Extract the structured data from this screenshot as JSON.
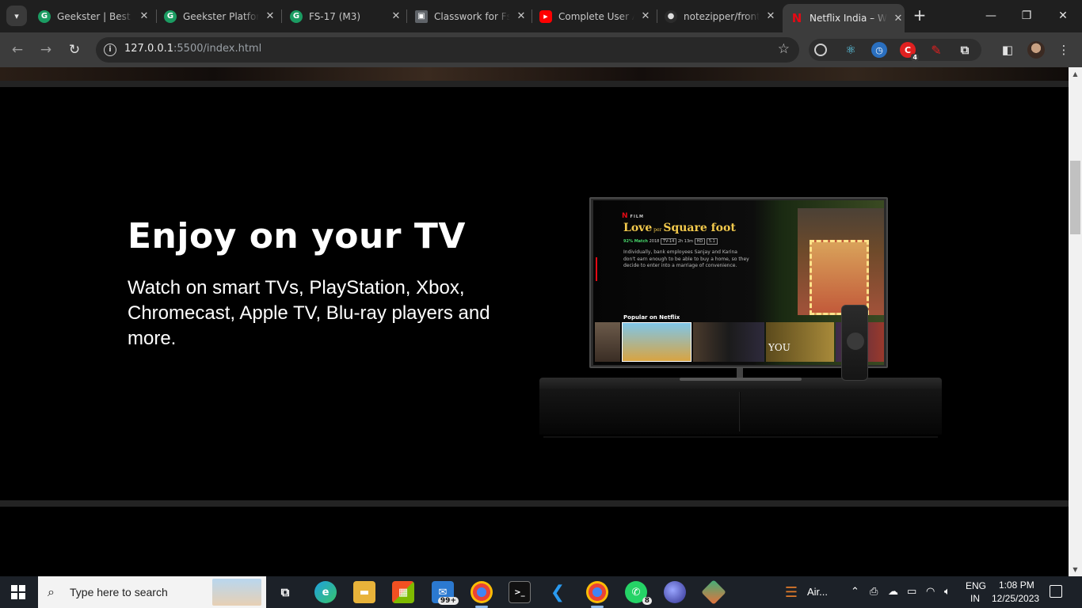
{
  "browser": {
    "tabs": [
      {
        "title": "Geekster | Best C",
        "favicon_color": "#1b9c62",
        "favicon_glyph": "G"
      },
      {
        "title": "Geekster Platform",
        "favicon_color": "#1b9c62",
        "favicon_glyph": "G"
      },
      {
        "title": "FS-17 (M3)",
        "favicon_color": "#1b9c62",
        "favicon_glyph": "G"
      },
      {
        "title": "Classwork for Fs",
        "favicon_color": "#5f6368",
        "favicon_glyph": "▣"
      },
      {
        "title": "Complete User A",
        "favicon_color": "#ff0000",
        "favicon_glyph": "▶"
      },
      {
        "title": "notezipper/front",
        "favicon_color": "#2b2b2b",
        "favicon_glyph": "●"
      },
      {
        "title": "Netflix India – W",
        "favicon_color": "#e50914",
        "favicon_glyph": "N",
        "active": true
      }
    ],
    "url_host": "127.0.0.1",
    "url_path": ":5500/index.html",
    "extension_badge": "4"
  },
  "page": {
    "headline": "Enjoy on your TV",
    "subtext": "Watch on smart TVs, PlayStation, Xbox, Chromecast, Apple TV, Blu-ray players and more.",
    "tv_screen": {
      "brand": "N",
      "brand_tag": "FILM",
      "title_part1": "Love",
      "title_small": "per",
      "title_part2": "Square foot",
      "match": "92% Match",
      "year": "2018",
      "rating": "TV-14",
      "duration": "2h 13m",
      "quality": "HD",
      "audio": "5.1",
      "description": "Individually, bank employees Sanjay and Karina don't earn enough to be able to buy a home, so they decide to enter into a marriage of convenience.",
      "row_title": "Popular on Netflix",
      "thumb_you": "YOU"
    }
  },
  "taskbar": {
    "search_placeholder": "Type here to search",
    "mail_badge": "99+",
    "whatsapp_badge": "8",
    "weather_text": "Air...",
    "lang_top": "ENG",
    "lang_bottom": "IN",
    "time": "1:08 PM",
    "date": "12/25/2023"
  }
}
